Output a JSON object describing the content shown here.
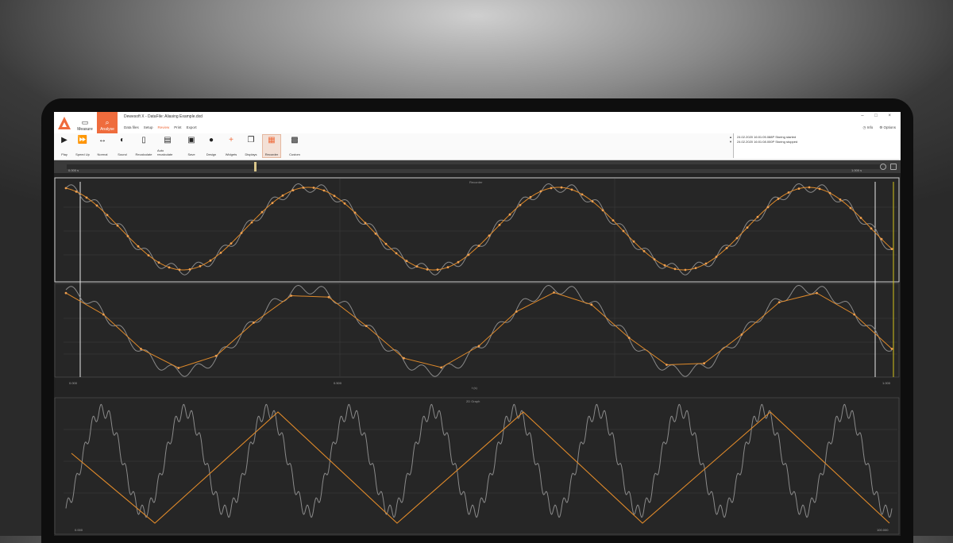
{
  "window": {
    "title": "Dewesoft X - DataFile: Aliasing Example.dxd",
    "controls": "– □ ×"
  },
  "mode_tabs": [
    {
      "label": "Measure",
      "glyph": "▭"
    },
    {
      "label": "Analyse",
      "glyph": "⌕"
    }
  ],
  "menu": [
    "Data files",
    "Setup",
    "Review",
    "Print",
    "Export"
  ],
  "menu_active_index": 2,
  "help": [
    "◷ Info",
    "⚙ Options"
  ],
  "toolbar": [
    {
      "label": "Play",
      "glyph": "▶"
    },
    {
      "label": "Speed Up",
      "glyph": "⏩"
    },
    {
      "label": "Normal",
      "glyph": "↔"
    },
    {
      "label": "Sound",
      "glyph": "◐"
    },
    {
      "label": "Recalculate",
      "glyph": "▯"
    },
    {
      "label": "Auto recalculate",
      "glyph": "▤"
    },
    {
      "label": "Save",
      "glyph": "▣"
    },
    {
      "label": "Design",
      "glyph": "●"
    },
    {
      "label": "Widgets",
      "glyph": "+"
    },
    {
      "label": "Displays",
      "glyph": "❐"
    },
    {
      "label": "Recorder",
      "glyph": "▦"
    },
    {
      "label": "Custom",
      "glyph": "▩"
    }
  ],
  "event_log": {
    "side": [
      "▲",
      "▼"
    ],
    "lines": [
      "24.02.2020 16:01:05.088P  Storing started",
      "24.02.2020 16:01:08.000P  Storing stopped"
    ]
  },
  "timeline": {
    "start_label": "0.000 s",
    "end_label": "1.000 s"
  },
  "recorder": {
    "title": "Recorder",
    "x_ticks": [
      "0.000",
      "0.500",
      "1.000"
    ],
    "x_label": "t (s)"
  },
  "xy_graph": {
    "title": "2D Graph",
    "x_ticks": [
      "0.000",
      "100.000"
    ]
  },
  "colors": {
    "accent": "#ef6c3d",
    "signal_gray": "#8a8a8a",
    "signal_orange": "#e08a2a",
    "plot_bg": "#262626"
  }
}
